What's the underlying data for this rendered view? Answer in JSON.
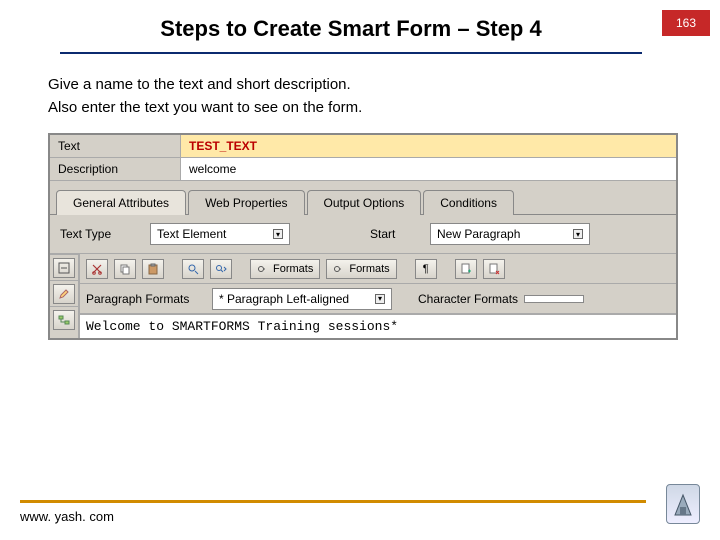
{
  "header": {
    "title": "Steps to Create Smart Form – Step 4",
    "page_number": "163"
  },
  "body": {
    "line1": "Give a name to the text and short description.",
    "line2": "Also enter the text you want to see on the form."
  },
  "sap": {
    "fields": {
      "text_label": "Text",
      "text_value": "TEST_TEXT",
      "desc_label": "Description",
      "desc_value": "welcome"
    },
    "tabs": {
      "t0": "General Attributes",
      "t1": "Web Properties",
      "t2": "Output Options",
      "t3": "Conditions"
    },
    "attrs": {
      "type_label": "Text Type",
      "type_value": "Text Element",
      "start_label": "Start",
      "start_value": "New Paragraph"
    },
    "toolbar": {
      "formats1": "Formats",
      "formats2": "Formats",
      "para_formats_label": "Paragraph Formats",
      "para_formats_value": "* Paragraph Left-aligned",
      "char_formats_label": "Character Formats"
    },
    "editor": {
      "text": "Welcome to SMARTFORMS Training sessions*"
    }
  },
  "footer": {
    "url": "www. yash. com"
  }
}
